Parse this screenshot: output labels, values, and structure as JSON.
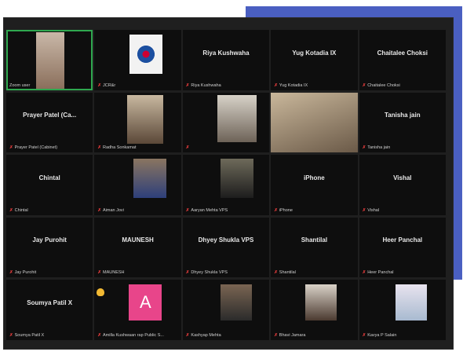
{
  "participants": [
    {
      "label": "Zoom user",
      "big": ""
    },
    {
      "label": "JCR&r",
      "big": ""
    },
    {
      "label": "Riya Kushwaha",
      "big": "Riya Kushwaha"
    },
    {
      "label": "Yug Kotadia IX",
      "big": "Yug Kotadia IX"
    },
    {
      "label": "Chaitalee Choksi",
      "big": "Chaitalee Choksi"
    },
    {
      "label": "Prayer Patel (Cabinet)",
      "big": "Prayer Patel (Ca..."
    },
    {
      "label": "Radha Sonkamat",
      "big": ""
    },
    {
      "label": "",
      "big": ""
    },
    {
      "label": "",
      "big": ""
    },
    {
      "label": "Tanisha jain",
      "big": "Tanisha jain"
    },
    {
      "label": "Chintal",
      "big": "Chintal"
    },
    {
      "label": "Aiman Jovi",
      "big": ""
    },
    {
      "label": "Aaryan Mehta VPS",
      "big": ""
    },
    {
      "label": "iPhone",
      "big": "iPhone"
    },
    {
      "label": "Vishal",
      "big": "Vishal"
    },
    {
      "label": "Jay Purohit",
      "big": "Jay Purohit"
    },
    {
      "label": "MAUNESH",
      "big": "MAUNESH"
    },
    {
      "label": "Dhyey Shukla VPS",
      "big": "Dhyey Shukla VPS"
    },
    {
      "label": "Shantilal",
      "big": "Shantilal"
    },
    {
      "label": "Heer Panchal",
      "big": "Heer Panchal"
    },
    {
      "label": "Soumya Patil X",
      "big": "Soumya Patil X"
    },
    {
      "label": "Amilla Kushwaan rap Public S...",
      "big": ""
    },
    {
      "label": "Kashyap Mehta",
      "big": ""
    },
    {
      "label": "Bhavi Jamara",
      "big": ""
    },
    {
      "label": "Kavya P Salain",
      "big": ""
    }
  ],
  "avatar_letter": "A",
  "colors": {
    "accent_blue": "#4a5fc1",
    "active_border": "#2fa84f",
    "mic_muted": "#e23b3b",
    "avatar_pink": "#e8458a"
  }
}
